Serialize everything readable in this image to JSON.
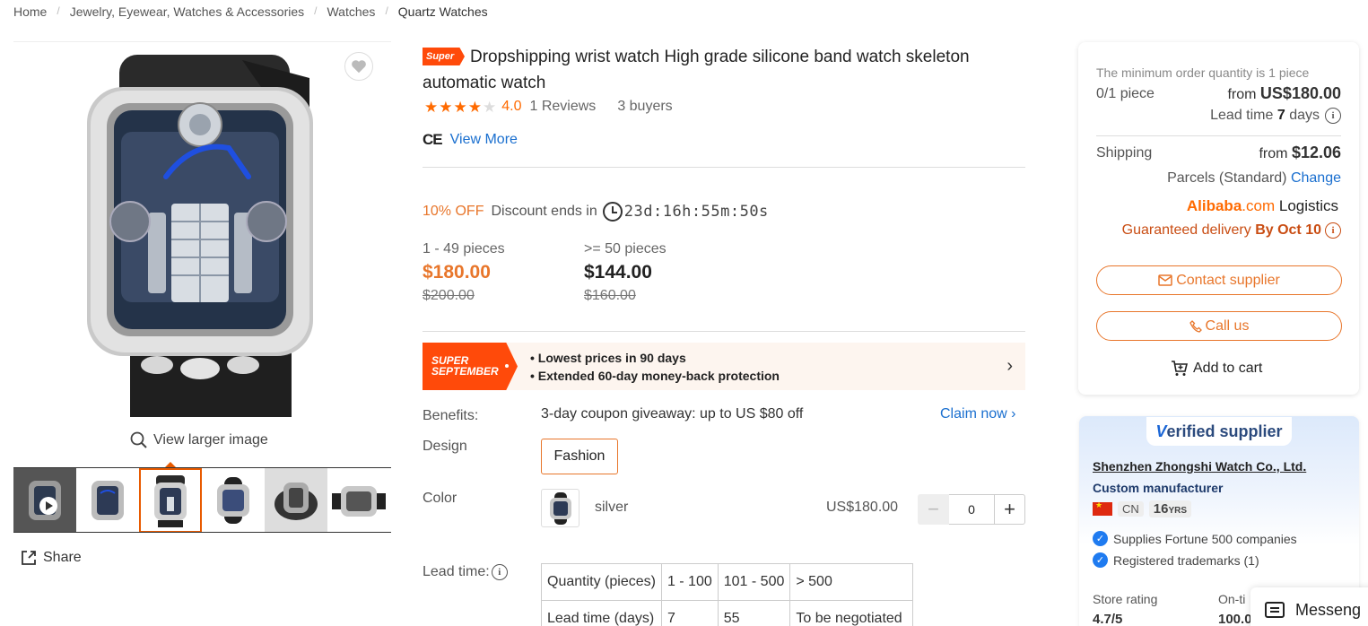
{
  "breadcrumb": [
    "Home",
    "Jewelry, Eyewear, Watches & Accessories",
    "Watches",
    "Quartz Watches"
  ],
  "gallery": {
    "view_larger": "View larger image",
    "share": "Share",
    "thumb_count": 6,
    "active_thumb": 2
  },
  "product": {
    "badge": "Super",
    "title": "Dropshipping wrist watch High grade silicone band watch skeleton automatic watch",
    "rating": 4.0,
    "rating_text": "4.0",
    "reviews": "1 Reviews",
    "buyers": "3 buyers",
    "cert_mark": "CE",
    "view_more": "View More"
  },
  "discount": {
    "off": "10% OFF",
    "ends_label": "Discount ends in",
    "countdown": "23d:16h:55m:50s"
  },
  "tiers": [
    {
      "qty": "1 - 49 pieces",
      "price": "$180.00",
      "original": "$200.00"
    },
    {
      "qty": ">= 50 pieces",
      "price": "$144.00",
      "original": "$160.00"
    }
  ],
  "promo": {
    "tag_line1": "SUPER",
    "tag_line2": "SEPTEMBER",
    "points": [
      "Lowest prices in 90 days",
      "Extended 60-day money-back protection"
    ]
  },
  "benefits": {
    "label": "Benefits:",
    "text": "3-day coupon giveaway: up to US $80 off",
    "claim": "Claim now"
  },
  "design": {
    "label": "Design",
    "option": "Fashion"
  },
  "color": {
    "label": "Color",
    "name": "silver",
    "price": "US$180.00",
    "quantity": "0"
  },
  "lead_time": {
    "label": "Lead time:",
    "rows": [
      [
        "Quantity (pieces)",
        "1 - 100",
        "101 - 500",
        "> 500"
      ],
      [
        "Lead time (days)",
        "7",
        "55",
        "To be negotiated"
      ]
    ]
  },
  "order": {
    "moq_note": "The minimum order quantity is 1 piece",
    "piece_count": "0/1 piece",
    "from_label": "from",
    "from_price": "US$180.00",
    "lead_label": "Lead time",
    "lead_days": "7",
    "lead_unit": "days",
    "shipping_label": "Shipping",
    "shipping_from": "from",
    "shipping_price": "$12.06",
    "parcels": "Parcels (Standard)",
    "change": "Change",
    "logistics_brand": "Alibaba",
    "logistics_com": ".com",
    "logistics_word": "Logistics",
    "guaranteed": "Guaranteed delivery",
    "guaranteed_date": "By Oct 10",
    "contact": "Contact supplier",
    "call": "Call us",
    "cart": "Add to cart"
  },
  "supplier": {
    "badge_v": "V",
    "badge_text": "erified supplier",
    "name": "Shenzhen Zhongshi Watch Co., Ltd.",
    "type": "Custom manufacturer",
    "country": "CN",
    "years": "16",
    "years_unit": "YRS",
    "features": [
      "Supplies Fortune 500 companies",
      "Registered trademarks (1)"
    ],
    "store_rating_label": "Store rating",
    "store_rating": "4.7/5",
    "ontime_label": "On-ti",
    "ontime_value": "100.0"
  },
  "messenger": "Messeng",
  "colors": {
    "accent": "#e8762b",
    "link": "#1a6fcf",
    "super_red": "#ff4a0a",
    "star": "#ff6a00"
  }
}
